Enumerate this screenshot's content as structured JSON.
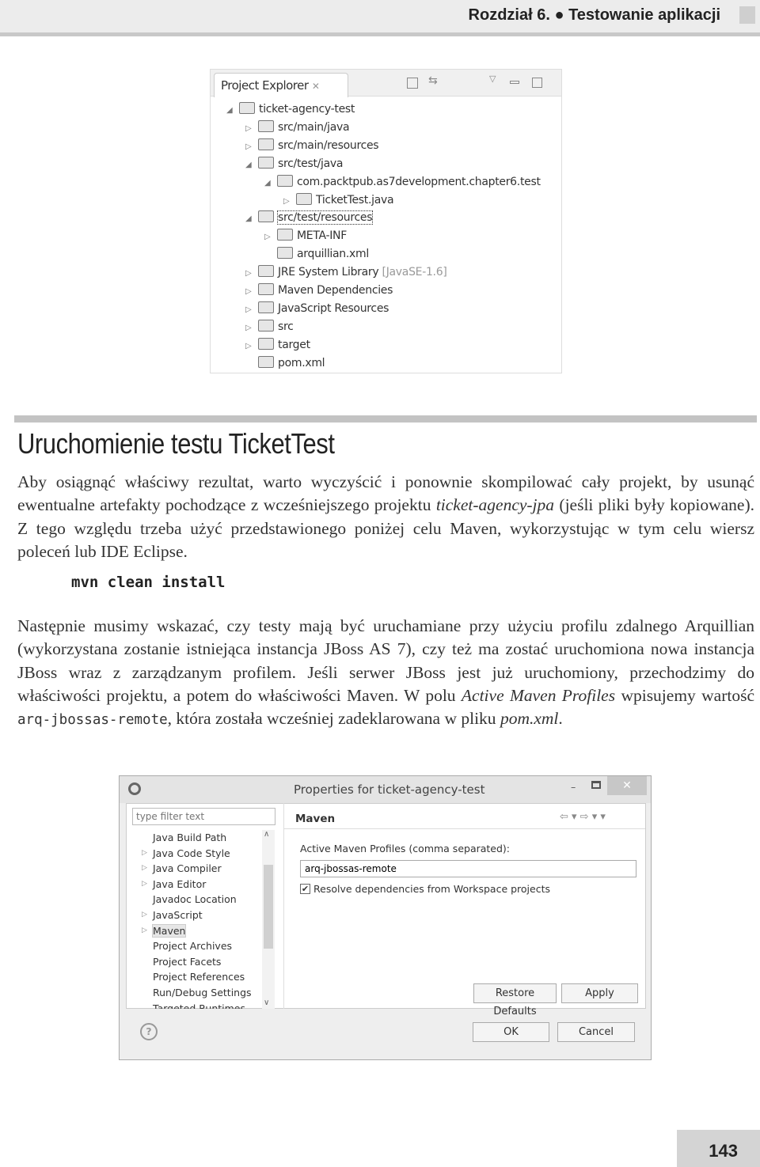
{
  "header": {
    "chapter": "Rozdział 6. ● Testowanie aplikacji"
  },
  "project_explorer": {
    "tab": "Project Explorer",
    "tree": [
      {
        "label": "ticket-agency-test",
        "level": 0,
        "state": "expanded"
      },
      {
        "label": "src/main/java",
        "level": 1,
        "state": "collapsed"
      },
      {
        "label": "src/main/resources",
        "level": 1,
        "state": "collapsed"
      },
      {
        "label": "src/test/java",
        "level": 1,
        "state": "expanded"
      },
      {
        "label": "com.packtpub.as7development.chapter6.test",
        "level": 2,
        "state": "expanded"
      },
      {
        "label": "TicketTest.java",
        "level": 3,
        "state": "collapsed"
      },
      {
        "label": "src/test/resources",
        "level": 1,
        "state": "expanded",
        "selected": true
      },
      {
        "label": "META-INF",
        "level": 2,
        "state": "collapsed"
      },
      {
        "label": "arquillian.xml",
        "level": 2,
        "state": "leaf"
      },
      {
        "label": "JRE System Library",
        "suffix": "[JavaSE-1.6]",
        "level": 1,
        "state": "collapsed"
      },
      {
        "label": "Maven Dependencies",
        "level": 1,
        "state": "collapsed"
      },
      {
        "label": "JavaScript Resources",
        "level": 1,
        "state": "collapsed"
      },
      {
        "label": "src",
        "level": 1,
        "state": "collapsed"
      },
      {
        "label": "target",
        "level": 1,
        "state": "collapsed"
      },
      {
        "label": "pom.xml",
        "level": 1,
        "state": "leaf"
      }
    ]
  },
  "section": {
    "title": "Uruchomienie testu TicketTest"
  },
  "para1": {
    "a": "Aby osiągnąć właściwy rezultat, warto wyczyścić i ponownie skompilować cały projekt, by usunąć ewentualne artefakty pochodzące z wcześniejszego projektu ",
    "b": "ticket-agency-jpa",
    "c": " (jeśli pliki były kopiowane). Z tego względu trzeba użyć przedstawionego poniżej celu Maven, wykorzystując w tym celu wiersz poleceń lub IDE Eclipse."
  },
  "code": "mvn clean install",
  "para2": {
    "a": "Następnie musimy wskazać, czy testy mają być uruchamiane przy użyciu profilu zdalnego Arquillian (wykorzystana zostanie istniejąca instancja JBoss AS 7), czy też ma zostać uruchomiona nowa instancja JBoss wraz z zarządzanym profilem. Jeśli serwer JBoss jest już uruchomiony, przechodzimy do właściwości projektu, a potem do właściwości Maven. W polu ",
    "b": "Active Maven Profiles",
    "c": " wpisujemy wartość ",
    "d": "arq-jbossas-remote",
    "e": ", która została wcześniej zadeklarowana w pliku ",
    "f": "pom.xml",
    "g": "."
  },
  "dialog": {
    "title": "Properties for ticket-agency-test",
    "filter_placeholder": "type filter text",
    "nav": [
      {
        "label": "Java Build Path",
        "arrow": false
      },
      {
        "label": "Java Code Style",
        "arrow": true
      },
      {
        "label": "Java Compiler",
        "arrow": true
      },
      {
        "label": "Java Editor",
        "arrow": true
      },
      {
        "label": "Javadoc Location",
        "arrow": false
      },
      {
        "label": "JavaScript",
        "arrow": true
      },
      {
        "label": "Maven",
        "arrow": true,
        "selected": true
      },
      {
        "label": "Project Archives",
        "arrow": false
      },
      {
        "label": "Project Facets",
        "arrow": false
      },
      {
        "label": "Project References",
        "arrow": false
      },
      {
        "label": "Run/Debug Settings",
        "arrow": false
      },
      {
        "label": "Targeted Runtimes",
        "arrow": false
      }
    ],
    "page_title": "Maven",
    "profiles_label": "Active Maven Profiles (comma separated):",
    "profiles_value": "arq-jbossas-remote",
    "resolve_label": "Resolve dependencies from Workspace projects",
    "resolve_checked": true,
    "restore_defaults": "Restore Defaults",
    "apply": "Apply",
    "ok": "OK",
    "cancel": "Cancel"
  },
  "footer": {
    "page_number": "143"
  }
}
